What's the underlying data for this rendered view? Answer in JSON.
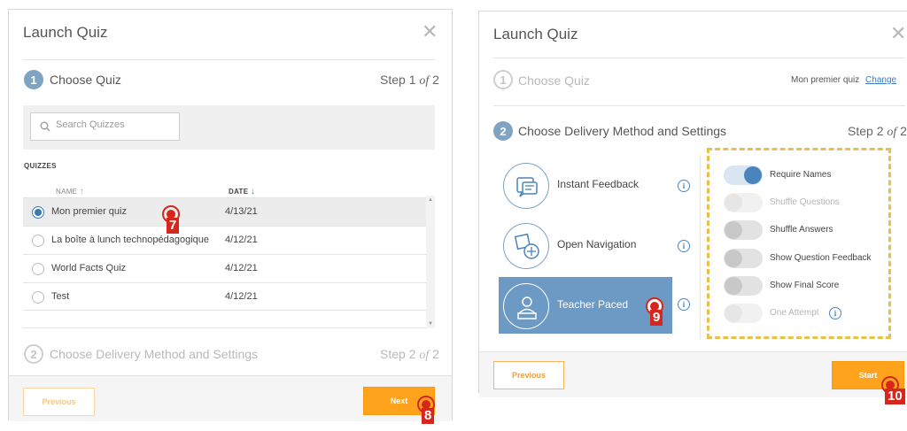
{
  "colors": {
    "accent": "#ffa21c",
    "step_active": "#7fa3c3",
    "selected_method": "#6c9ac4",
    "marker": "#d8261c",
    "highlight_box": "#e8c04a"
  },
  "left": {
    "title": "Launch Quiz",
    "close_icon": "close-icon",
    "step1": {
      "number": "1",
      "title": "Choose Quiz",
      "count_prefix": "Step 1 ",
      "count_of": "of",
      "count_total": " 2"
    },
    "search": {
      "placeholder": "Search Quizzes",
      "value": ""
    },
    "quizzes_label": "QUIZZES",
    "columns": {
      "name": "NAME",
      "date": "DATE"
    },
    "rows": [
      {
        "name": "Mon premier quiz",
        "date": "4/13/21",
        "selected": true
      },
      {
        "name": "La boîte à lunch technopédagogique",
        "date": "4/12/21",
        "selected": false
      },
      {
        "name": "World Facts Quiz",
        "date": "4/12/21",
        "selected": false
      },
      {
        "name": "Test",
        "date": "4/12/21",
        "selected": false
      }
    ],
    "step2": {
      "number": "2",
      "title": "Choose Delivery Method and Settings",
      "count_prefix": "Step 2 ",
      "count_of": "of",
      "count_total": " 2"
    },
    "previous_label": "Previous",
    "next_label": "Next"
  },
  "right": {
    "title": "Launch Quiz",
    "close_icon": "close-icon",
    "step1": {
      "number": "1",
      "title": "Choose Quiz",
      "selected_quiz": "Mon premier quiz",
      "change_label": "Change"
    },
    "step2": {
      "number": "2",
      "title": "Choose Delivery Method and Settings",
      "count_prefix": "Step 2 ",
      "count_of": "of",
      "count_total": " 2"
    },
    "methods": [
      {
        "label": "Instant Feedback",
        "icon": "instant-feedback-icon",
        "selected": false
      },
      {
        "label": "Open Navigation",
        "icon": "open-navigation-icon",
        "selected": false
      },
      {
        "label": "Teacher Paced",
        "icon": "teacher-paced-icon",
        "selected": true
      }
    ],
    "settings": [
      {
        "label": "Require Names",
        "state": "on"
      },
      {
        "label": "Shuffle Questions",
        "state": "disabled"
      },
      {
        "label": "Shuffle Answers",
        "state": "off"
      },
      {
        "label": "Show Question Feedback",
        "state": "off"
      },
      {
        "label": "Show Final Score",
        "state": "off"
      },
      {
        "label": "One Attempt",
        "state": "disabled"
      }
    ],
    "previous_label": "Previous",
    "start_label": "Start"
  },
  "markers": {
    "m7": "7",
    "m8": "8",
    "m9": "9",
    "m10": "10"
  }
}
